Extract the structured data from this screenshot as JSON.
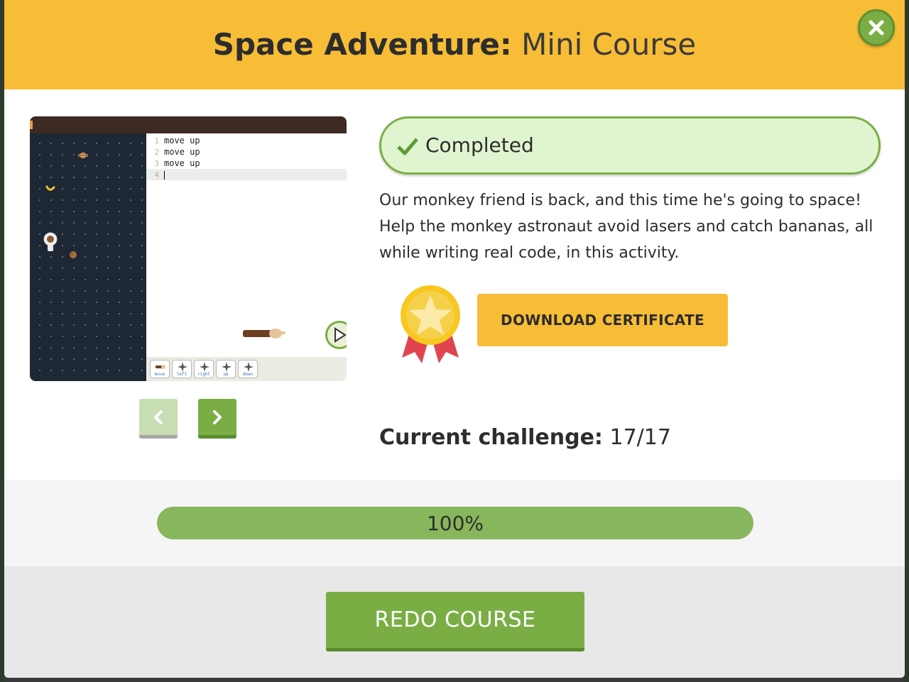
{
  "modal": {
    "title_bold": "Space Adventure:",
    "title_light": "Mini Course",
    "close_icon": "close-x-icon"
  },
  "preview": {
    "code_lines": [
      {
        "num": "1",
        "text": "move up"
      },
      {
        "num": "2",
        "text": "move up"
      },
      {
        "num": "3",
        "text": "move up"
      },
      {
        "num": "4",
        "text": ""
      }
    ],
    "palette": [
      {
        "label": "move",
        "icon": "monkey-arm-icon"
      },
      {
        "label": "left",
        "icon": "compass-left-icon"
      },
      {
        "label": "right",
        "icon": "compass-right-icon"
      },
      {
        "label": "up",
        "icon": "compass-up-icon"
      },
      {
        "label": "down",
        "icon": "compass-down-icon"
      }
    ]
  },
  "pager": {
    "prev_icon": "chevron-left-icon",
    "next_icon": "chevron-right-icon"
  },
  "status": {
    "text": "Completed",
    "icon": "checkmark-icon"
  },
  "description": "Our monkey friend is back, and this time he's going to space! Help the monkey astronaut avoid lasers and catch bananas, all while writing real code, in this activity.",
  "certificate": {
    "button_label": "DOWNLOAD CERTIFICATE",
    "icon": "medal-star-icon"
  },
  "challenge": {
    "label": "Current challenge:",
    "value": "17/17"
  },
  "progress": {
    "percent": 100,
    "label": "100%"
  },
  "footer": {
    "redo_label": "REDO COURSE"
  },
  "colors": {
    "header": "#f8bd36",
    "accent_green": "#7aae45",
    "completed_bg": "#e0f5cf"
  }
}
